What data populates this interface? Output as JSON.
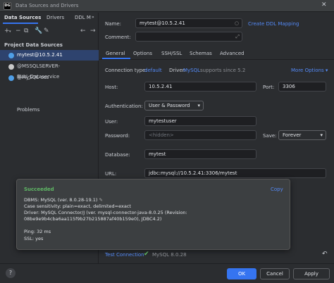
{
  "window": {
    "title": "Data Sources and Drivers",
    "app_icon": "DG"
  },
  "left": {
    "tabs": [
      "Data Sources",
      "Drivers",
      "DDL M"
    ],
    "section": "Project Data Sources",
    "items": [
      {
        "label": "mytest@10.5.2.41",
        "icon_color": "#4f9fe8"
      },
      {
        "label": "@MSSQLSERVER-BUU_Dataservice",
        "icon_color": "#c9c9c9"
      },
      {
        "label": "@MySQL-oss",
        "icon_color": "#4f9fe8"
      }
    ],
    "problems": "Problems"
  },
  "form": {
    "name_label": "Name:",
    "name_value": "mytest@10.5.2.41",
    "create_ddl": "Create DDL Mapping",
    "comment_label": "Comment:",
    "tabs": [
      "General",
      "Options",
      "SSH/SSL",
      "Schemas",
      "Advanced"
    ],
    "conn_type_label": "Connection type:",
    "conn_type_value": "default",
    "driver_label": "Driver:",
    "driver_value": "MySQL",
    "driver_note": "supports since 5.2",
    "more_options": "More Options",
    "host_label": "Host:",
    "host_value": "10.5.2.41",
    "port_label": "Port:",
    "port_value": "3306",
    "auth_label": "Authentication:",
    "auth_value": "User & Password",
    "user_label": "User:",
    "user_value": "mytestuser",
    "password_label": "Password:",
    "password_value": "<hidden>",
    "save_label": "Save:",
    "save_value": "Forever",
    "database_label": "Database:",
    "database_value": "mytest",
    "url_label": "URL:",
    "url_value": "jdbc:mysql://10.5.2.41:3306/mytest"
  },
  "popup": {
    "status": "Succeeded",
    "copy": "Copy",
    "dbms": "DBMS: MySQL (ver. 8.0.28-19.1)",
    "case": "Case sensitivity: plain=exact, delimited=exact",
    "driver": "Driver: MySQL Connector/J (ver. mysql-connector-java-8.0.25 (Revision:",
    "revision": "08be9e9b4cba6aa115f9b27b215887af40b159e0), JDBC4.2)",
    "ping": "Ping: 32 ms",
    "ssl": "SSL: yes"
  },
  "footer": {
    "test_connection": "Test Connection",
    "test_result": "MySQL 8.0.28",
    "ok": "OK",
    "cancel": "Cancel",
    "apply": "Apply",
    "help": "?"
  },
  "colors": {
    "accent": "#3574f0",
    "success": "#5fb865",
    "link": "#548af7"
  }
}
